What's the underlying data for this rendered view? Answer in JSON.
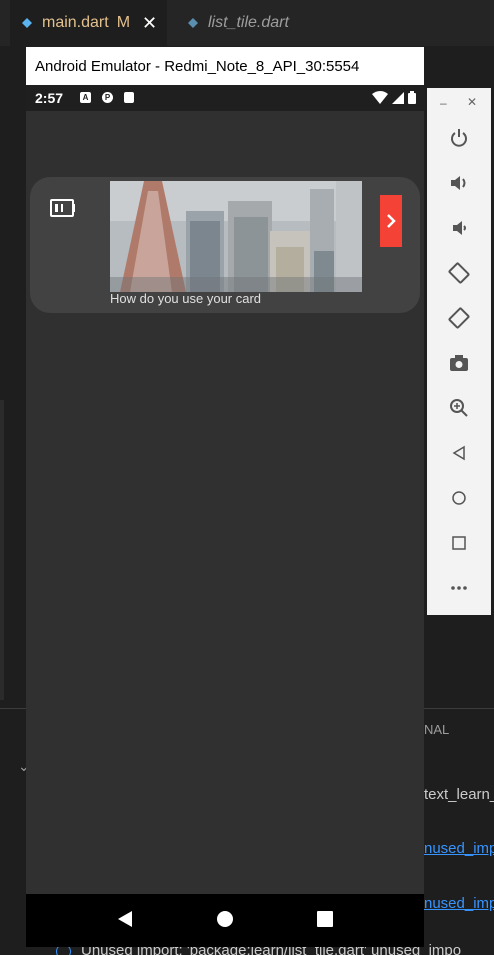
{
  "vscode": {
    "tabs": [
      {
        "label": "main.dart",
        "modified": "M"
      },
      {
        "label": "list_tile.dart"
      }
    ],
    "panel": {
      "tab_label": "NAL",
      "lines": [
        "text_learn_",
        "nused_imp",
        "nused_imp"
      ],
      "bottom_text": "Unused import: 'package:learn/list_tile.dart' unused_impo"
    }
  },
  "emulator": {
    "title": "Android Emulator - Redmi_Note_8_API_30:5554",
    "status_time": "2:57",
    "card": {
      "subtitle": "How do you use your card"
    },
    "sidebar_icons": [
      "power-icon",
      "volume-up-icon",
      "volume-down-icon",
      "rotate-left-icon",
      "rotate-right-icon",
      "camera-icon",
      "zoom-icon",
      "back-icon",
      "home-icon",
      "overview-icon",
      "more-icon"
    ]
  },
  "colors": {
    "tab_modified": "#e2c08d",
    "trailing_button": "#f44336",
    "card_bg": "#424242",
    "screen_bg": "#303030"
  }
}
